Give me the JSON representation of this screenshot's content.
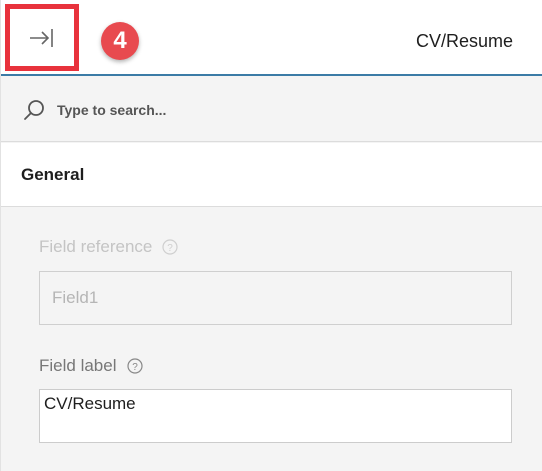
{
  "header": {
    "collapse_label": "",
    "step_number": "4",
    "title": "CV/Resume"
  },
  "search": {
    "placeholder": "Type to search...",
    "value": ""
  },
  "section": {
    "title": "General"
  },
  "fields": {
    "reference": {
      "label": "Field reference",
      "value": "Field1"
    },
    "label": {
      "label": "Field label",
      "value": "CV/Resume"
    }
  },
  "colors": {
    "highlight": "#e8323c",
    "badge": "#e84a4f",
    "accent_line": "#3b7ba6"
  }
}
